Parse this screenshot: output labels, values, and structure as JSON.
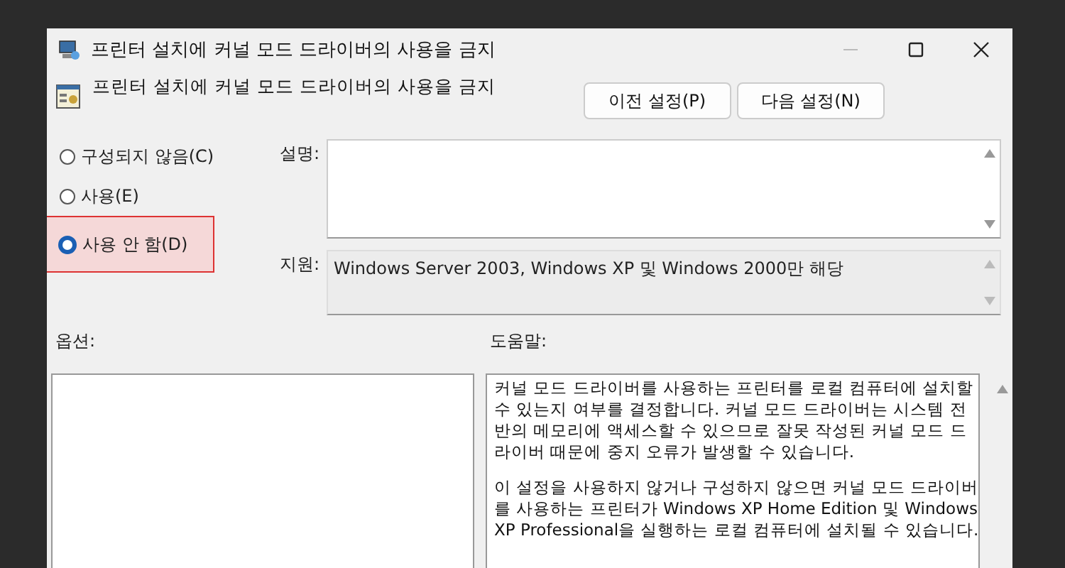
{
  "window": {
    "title": "프린터 설치에 커널 모드 드라이버의 사용을 금지"
  },
  "header": {
    "policy_name": "프린터 설치에 커널 모드 드라이버의 사용을 금지",
    "buttons": [
      "이전 설정(P)",
      "다음 설정(N)"
    ]
  },
  "options": [
    {
      "label": "구성되지 않음(C)",
      "selected": false,
      "highlighted": false
    },
    {
      "label": "사용(E)",
      "selected": false,
      "highlighted": false
    },
    {
      "label": "사용 안 함(D)",
      "selected": true,
      "highlighted": true
    }
  ],
  "comment": {
    "label": "설명:"
  },
  "supported_on": {
    "label": "지원:",
    "value": "Windows Server 2003, Windows XP 및 Windows 2000만 해당"
  },
  "options_panel": {
    "label": "옵션:"
  },
  "help": {
    "label": "도움말:",
    "paragraphs": [
      [
        "커널 모드 드라이버를 사용하는 프린터를 로컬 컴퓨터에 설치할",
        "수 있는지 여부를 결정합니다.  커널 모드 드라이버는 시스템 전",
        "반의 메모리에 액세스할 수 있으므로 잘못 작성된 커널 모드 드",
        "라이버 때문에 중지 오류가 발생할 수 있습니다."
      ],
      [
        "이 설정을 사용하지 않거나 구성하지 않으면 커널 모드 드라이버",
        "를 사용하는 프린터가 Windows XP Home Edition 및 Windows",
        "XP Professional을 실행하는 로컬 컴퓨터에 설치될 수 있습니다."
      ]
    ]
  }
}
